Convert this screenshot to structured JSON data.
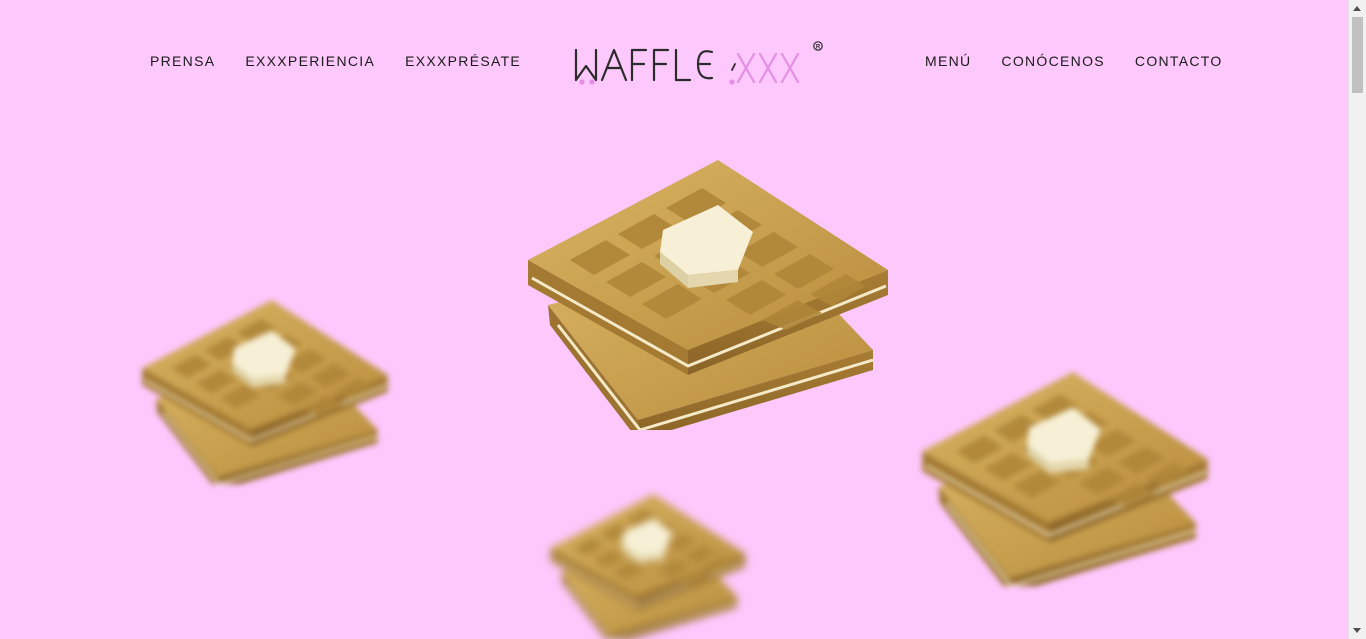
{
  "header": {
    "nav_left": [
      {
        "label": "PRENSA"
      },
      {
        "label": "EXXXPERIENCIA"
      },
      {
        "label": "EXXXPRÉSATE"
      }
    ],
    "nav_right": [
      {
        "label": "MENÚ"
      },
      {
        "label": "CONÓCENOS"
      },
      {
        "label": "CONTACTO"
      }
    ],
    "logo": {
      "text_main": "WAFFLE",
      "text_accent": "XXX",
      "registered": "®"
    }
  },
  "colors": {
    "background": "#fdc8fc",
    "logo_dark": "#2b2b2b",
    "logo_accent": "#e58ee6",
    "waffle": "#c9a052",
    "butter": "#f6efd0"
  },
  "hero": {
    "images": [
      {
        "name": "waffle-main-icon"
      },
      {
        "name": "waffle-left-icon"
      },
      {
        "name": "waffle-right-icon"
      },
      {
        "name": "waffle-bottom-icon"
      }
    ]
  }
}
